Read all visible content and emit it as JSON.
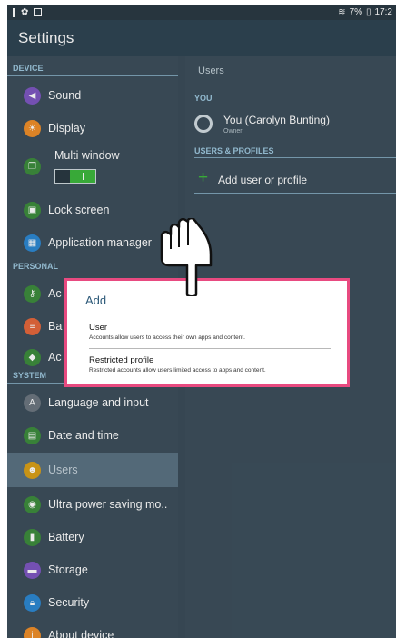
{
  "status_bar": {
    "time": "17:2",
    "battery": "7%"
  },
  "app_bar": {
    "title": "Settings"
  },
  "sidebar": {
    "sections": [
      {
        "label": "DEVICE"
      },
      {
        "label": "PERSONAL"
      },
      {
        "label": "SYSTEM"
      }
    ],
    "items": [
      {
        "label": "Sound",
        "icon": "speaker-icon",
        "color": "#7e57c2"
      },
      {
        "label": "Display",
        "icon": "display-icon",
        "color": "#ef8f2a"
      },
      {
        "label": "Multi window",
        "icon": "multi-window-icon",
        "color": "#3d8c3d"
      },
      {
        "label": "Lock screen",
        "icon": "lock-screen-icon",
        "color": "#3d8c3d"
      },
      {
        "label": "Application manager",
        "icon": "app-manager-icon",
        "color": "#2d88d2"
      },
      {
        "label": "Ac",
        "icon": "accounts-icon",
        "color": "#3d8c3d"
      },
      {
        "label": "Ba",
        "icon": "backup-icon",
        "color": "#e5683c"
      },
      {
        "label": "Ac",
        "icon": "accessibility-icon",
        "color": "#3d8c3d"
      },
      {
        "label": "Language and input",
        "icon": "language-icon",
        "color": "#6d7780"
      },
      {
        "label": "Date and time",
        "icon": "date-time-icon",
        "color": "#3d8c3d"
      },
      {
        "label": "Users",
        "icon": "users-icon",
        "color": "#d9a018"
      },
      {
        "label": "Ultra power saving mo..",
        "icon": "power-saving-icon",
        "color": "#3d8c3d"
      },
      {
        "label": "Battery",
        "icon": "battery-icon",
        "color": "#3d8c3d"
      },
      {
        "label": "Storage",
        "icon": "storage-icon",
        "color": "#7e57c2"
      },
      {
        "label": "Security",
        "icon": "security-icon",
        "color": "#2d88d2"
      },
      {
        "label": "About device",
        "icon": "about-icon",
        "color": "#ef8f2a"
      }
    ],
    "multi_window_enabled": true
  },
  "right_pane": {
    "title": "Users",
    "you_header": "YOU",
    "user_name": "You (Carolyn Bunting)",
    "user_role": "Owner",
    "profiles_header": "USERS & PROFILES",
    "add_label": "Add user or profile"
  },
  "dialog": {
    "title": "Add",
    "options": [
      {
        "title": "User",
        "desc": "Accounts allow users to access their own apps and content."
      },
      {
        "title": "Restricted profile",
        "desc": "Restricted accounts allow users limited access to apps and content."
      }
    ],
    "border_color": "#e84a80"
  },
  "colors": {
    "accent_green": "#3db83d",
    "header_blue": "#9ec8df",
    "background": "#3d4f5c"
  }
}
